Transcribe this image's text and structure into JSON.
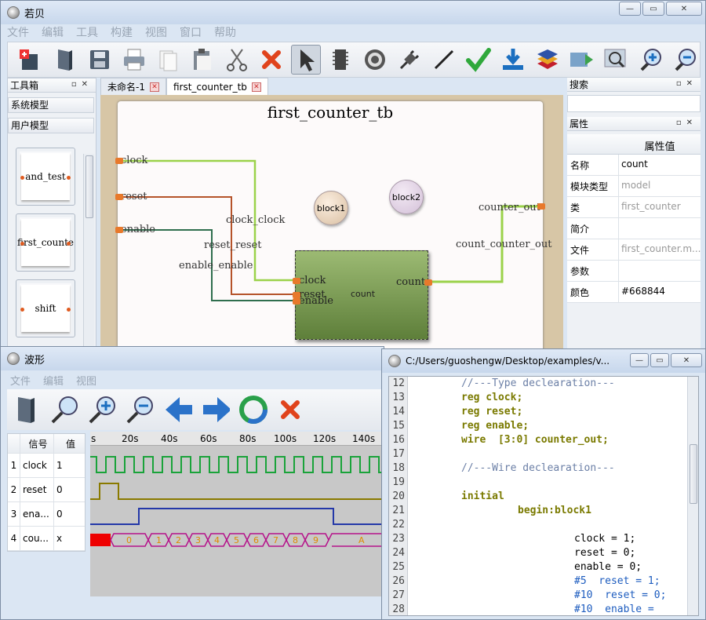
{
  "app": {
    "title": "若贝"
  },
  "menu": [
    "文件",
    "编辑",
    "工具",
    "构建",
    "视图",
    "窗口",
    "帮助"
  ],
  "toolbox": {
    "title": "工具箱",
    "system_models": "系统模型",
    "user_models": "用户模型",
    "components": [
      "and_test",
      "first_counte",
      "shift"
    ]
  },
  "tabs": [
    {
      "label": "未命名-1"
    },
    {
      "label": "first_counter_tb"
    }
  ],
  "diagram": {
    "title": "first_counter_tb",
    "ports_left": [
      "clock",
      "reset",
      "enable"
    ],
    "port_right": "counter_out",
    "wire_labels": [
      "clock_clock",
      "reset_reset",
      "enable_enable",
      "count_counter_out"
    ],
    "blocks": [
      "block1",
      "block2"
    ],
    "module": {
      "name": "count",
      "inputs": [
        "clock",
        "reset",
        "enable"
      ],
      "output": "count"
    }
  },
  "search_panel": {
    "title": "搜索"
  },
  "props_panel": {
    "title": "属性",
    "header_value": "属性值",
    "rows": [
      {
        "k": "名称",
        "v": "count"
      },
      {
        "k": "模块类型",
        "v": "model"
      },
      {
        "k": "类",
        "v": "first_counter"
      },
      {
        "k": "简介",
        "v": ""
      },
      {
        "k": "文件",
        "v": "first_counter.m..."
      },
      {
        "k": "参数",
        "v": ""
      },
      {
        "k": "颜色",
        "v": "#668844"
      }
    ]
  },
  "wave": {
    "title": "波形",
    "menu": [
      "文件",
      "编辑",
      "视图"
    ],
    "col_signal": "信号",
    "col_value": "值",
    "signals": [
      {
        "idx": "1",
        "name": "clock",
        "value": "1"
      },
      {
        "idx": "2",
        "name": "reset",
        "value": "0"
      },
      {
        "idx": "3",
        "name": "ena...",
        "value": "0"
      },
      {
        "idx": "4",
        "name": "cou...",
        "value": "x"
      }
    ],
    "ruler": [
      "s",
      "20s",
      "40s",
      "60s",
      "80s",
      "100s",
      "120s",
      "140s"
    ],
    "bus_values": [
      "0",
      "1",
      "2",
      "3",
      "4",
      "5",
      "6",
      "7",
      "8",
      "9",
      "A"
    ]
  },
  "code": {
    "title": "C:/Users/guoshengw/Desktop/examples/v...",
    "lines": [
      {
        "n": "12",
        "t": "//---Type declearation---"
      },
      {
        "n": "13",
        "t": "reg clock;"
      },
      {
        "n": "14",
        "t": "reg reset;"
      },
      {
        "n": "15",
        "t": "reg enable;"
      },
      {
        "n": "16",
        "t": "wire  [3:0] counter_out;"
      },
      {
        "n": "17",
        "t": ""
      },
      {
        "n": "18",
        "t": "//---Wire declearation---"
      },
      {
        "n": "19",
        "t": ""
      },
      {
        "n": "20",
        "t": "initial"
      },
      {
        "n": "21",
        "t": "begin:block1"
      },
      {
        "n": "22",
        "t": ""
      },
      {
        "n": "23",
        "t": "clock = 1;"
      },
      {
        "n": "24",
        "t": "reset = 0;"
      },
      {
        "n": "25",
        "t": "enable = 0;"
      },
      {
        "n": "26",
        "t": "#5  reset = 1;"
      },
      {
        "n": "27",
        "t": "#10  reset = 0;"
      },
      {
        "n": "28",
        "t": "#10  enable ="
      }
    ]
  },
  "colors": {
    "module_fill": "#668844",
    "clock_wire": "#9bd24a",
    "reset_wire": "#b5532a",
    "enable_wire": "#2f6e4e",
    "clock_wave": "#1aa33a",
    "reset_wave": "#8a7a00",
    "enable_wave": "#2438a8",
    "bus_wave": "#b5128a"
  }
}
